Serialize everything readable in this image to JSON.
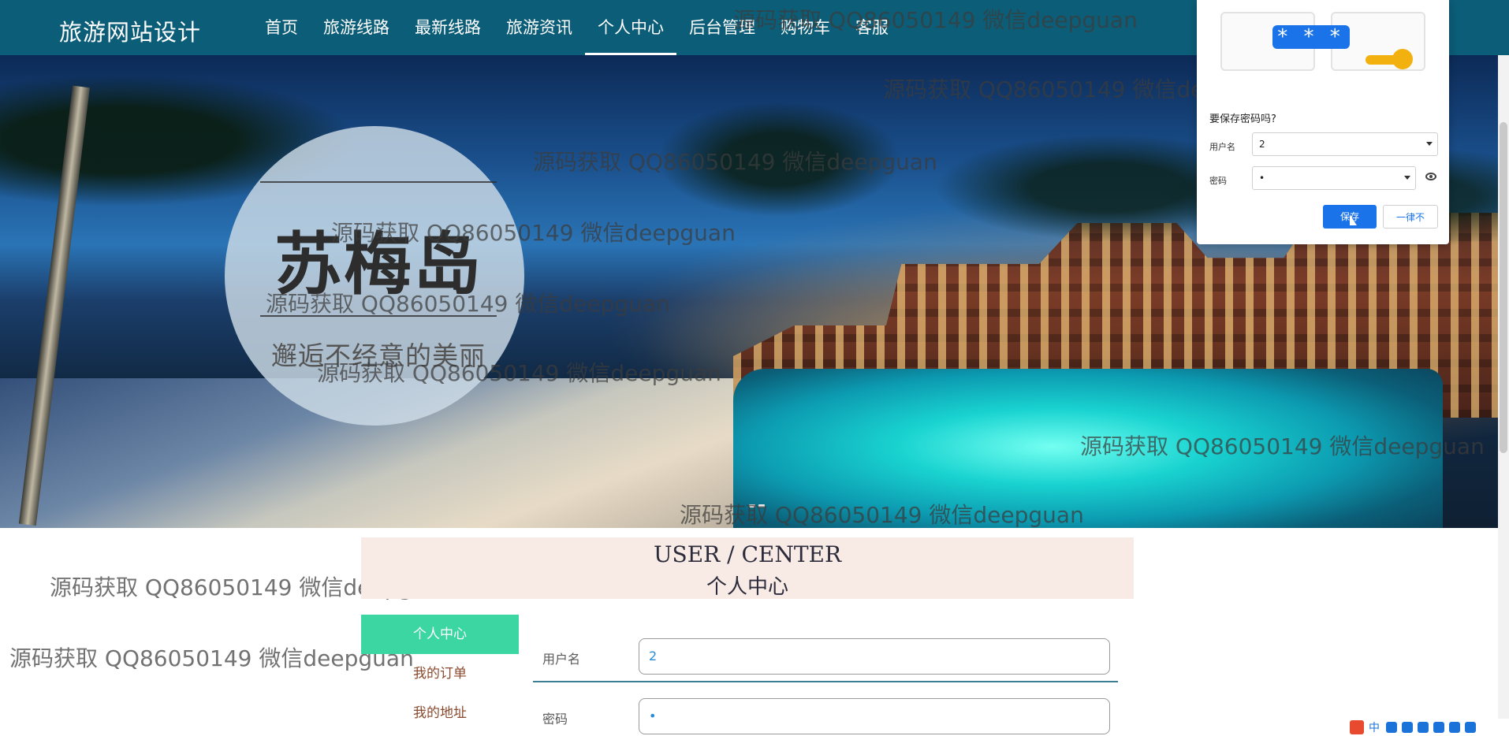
{
  "site": {
    "brand": "旅游网站设计",
    "nav": [
      {
        "label": "首页",
        "active": false
      },
      {
        "label": "旅游线路",
        "active": false
      },
      {
        "label": "最新线路",
        "active": false
      },
      {
        "label": "旅游资讯",
        "active": false
      },
      {
        "label": "个人中心",
        "active": true
      },
      {
        "label": "后台管理",
        "active": false
      },
      {
        "label": "购物车",
        "active": false
      },
      {
        "label": "客服",
        "active": false
      }
    ]
  },
  "hero": {
    "title": "苏梅岛",
    "subtitle": "邂逅不经意的美丽"
  },
  "watermark": {
    "text": "源码获取 QQ86050149 微信deepguan"
  },
  "password_popup": {
    "stars": "* * *",
    "question": "要保存密码吗?",
    "username_label": "用户名",
    "username_value": "2",
    "password_label": "密码",
    "password_value": "•",
    "save_label": "保存",
    "never_label": "一律不"
  },
  "user_center": {
    "banner_en": "USER / CENTER",
    "banner_cn": "个人中心",
    "sidebar": [
      {
        "label": "个人中心",
        "active": true
      },
      {
        "label": "我的订单",
        "active": false
      },
      {
        "label": "我的地址",
        "active": false
      }
    ],
    "form": {
      "username_label": "用户名",
      "username_value": "2",
      "password_label": "密码",
      "password_value": "•"
    }
  },
  "tray": {
    "ime": "中"
  }
}
